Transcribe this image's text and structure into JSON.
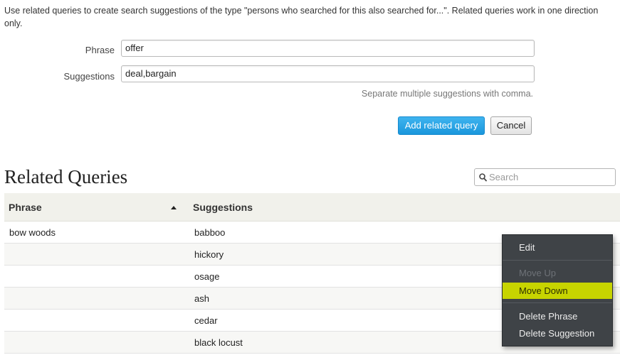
{
  "intro_text": "Use related queries to create search suggestions of the type \"persons who searched for this also searched for...\". Related queries work in one direction only.",
  "form": {
    "phrase_label": "Phrase",
    "phrase_value": "offer",
    "suggestions_label": "Suggestions",
    "suggestions_value": "deal,bargain",
    "hint": "Separate multiple suggestions with comma.",
    "add_button": "Add related query",
    "cancel_button": "Cancel"
  },
  "section_title": "Related Queries",
  "search": {
    "placeholder": "Search",
    "icon": "search-icon"
  },
  "table": {
    "columns": [
      "Phrase",
      "Suggestions"
    ],
    "sort": {
      "column": "Phrase",
      "direction": "ascending"
    },
    "rows": [
      {
        "phrase": "bow woods",
        "suggestion": "babboo"
      },
      {
        "phrase": "",
        "suggestion": "hickory"
      },
      {
        "phrase": "",
        "suggestion": "osage"
      },
      {
        "phrase": "",
        "suggestion": "ash"
      },
      {
        "phrase": "",
        "suggestion": "cedar"
      },
      {
        "phrase": "",
        "suggestion": "black locust"
      }
    ]
  },
  "context_menu": {
    "items": [
      {
        "label": "Edit",
        "state": "enabled"
      },
      {
        "label": "Move Up",
        "state": "disabled"
      },
      {
        "label": "Move Down",
        "state": "highlighted"
      },
      {
        "label": "Delete Phrase",
        "state": "enabled"
      },
      {
        "label": "Delete Suggestion",
        "state": "enabled"
      }
    ]
  },
  "colors": {
    "primary_button": "#1a97dc",
    "menu_background": "#3f4347",
    "menu_highlight": "#c7d400",
    "table_header": "#f1f1eb"
  }
}
